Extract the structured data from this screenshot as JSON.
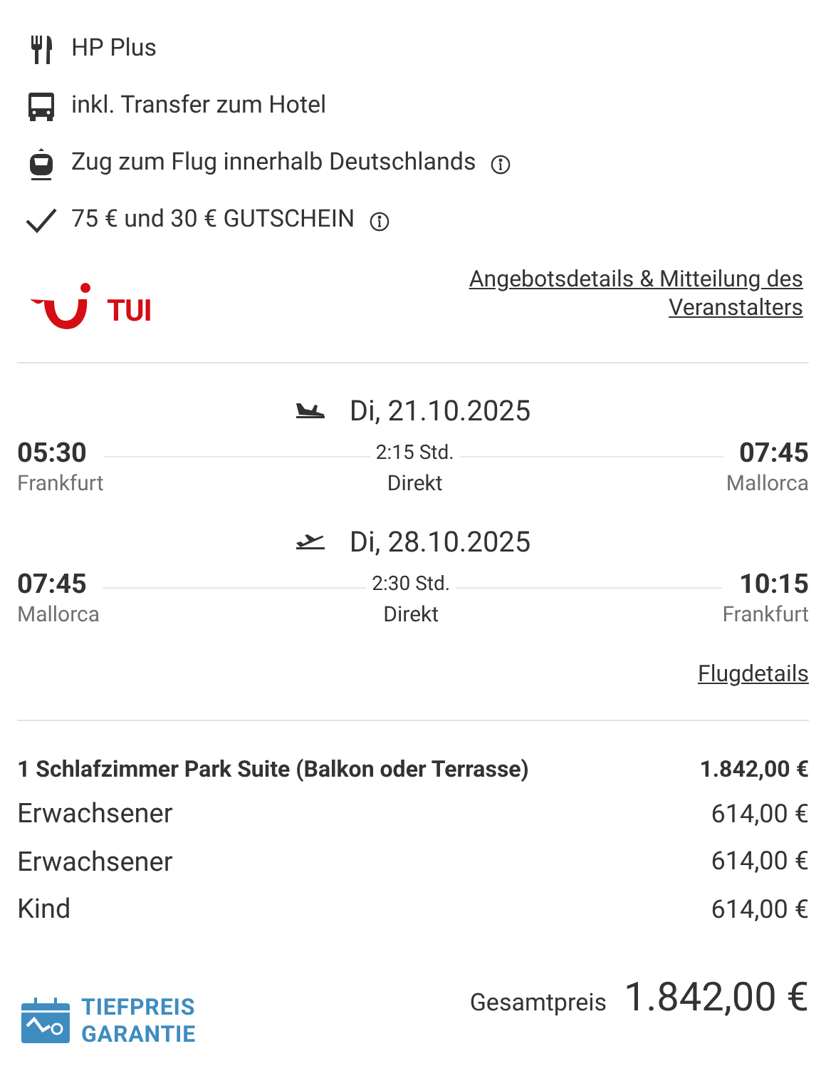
{
  "features": [
    {
      "text": "HP Plus",
      "info": false
    },
    {
      "text": "inkl. Transfer zum Hotel",
      "info": false
    },
    {
      "text": "Zug zum Flug innerhalb Deutschlands",
      "info": true
    },
    {
      "text": "75 € und 30 € GUTSCHEIN",
      "info": true
    }
  ],
  "operator": {
    "logo_text": "TUI",
    "link": "Angebotsdetails & Mitteilung des Veranstalters"
  },
  "flights": [
    {
      "date": "Di, 21.10.2025",
      "departure_time": "05:30",
      "departure_place": "Frankfurt",
      "duration": "2:15 Std.",
      "stops": "Direkt",
      "arrival_time": "07:45",
      "arrival_place": "Mallorca"
    },
    {
      "date": "Di, 28.10.2025",
      "departure_time": "07:45",
      "departure_place": "Mallorca",
      "duration": "2:30 Std.",
      "stops": "Direkt",
      "arrival_time": "10:15",
      "arrival_place": "Frankfurt"
    }
  ],
  "flight_details_link": "Flugdetails",
  "price_lines": [
    {
      "label": "1 Schlafzimmer Park Suite (Balkon oder Terrasse)",
      "amount": "1.842,00 €",
      "kind": "room"
    },
    {
      "label": "Erwachsener",
      "amount": "614,00 €",
      "kind": "person"
    },
    {
      "label": "Erwachsener",
      "amount": "614,00 €",
      "kind": "person"
    },
    {
      "label": "Kind",
      "amount": "614,00 €",
      "kind": "person"
    }
  ],
  "badge": {
    "line1": "TIEFPREIS",
    "line2": "GARANTIE"
  },
  "total": {
    "label": "Gesamtpreis",
    "amount": "1.842,00 €"
  }
}
